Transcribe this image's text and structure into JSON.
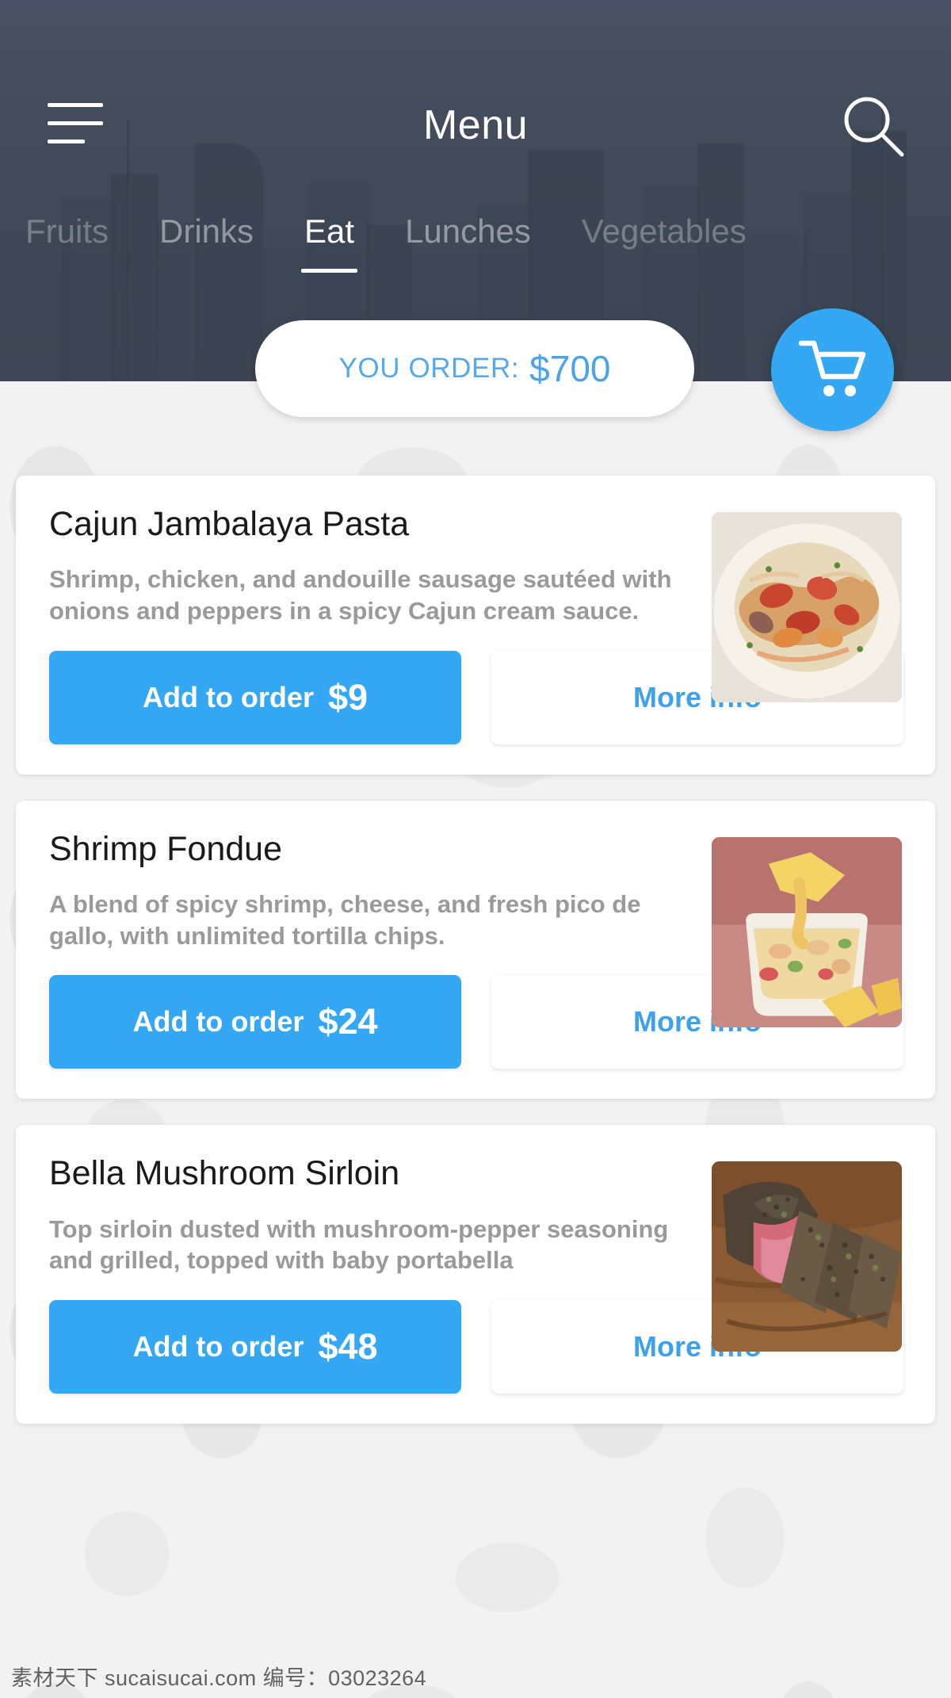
{
  "header": {
    "title": "Menu",
    "menu_icon": "hamburger-icon",
    "search_icon": "search-icon"
  },
  "tabs": [
    {
      "label": "Fruits",
      "active": false
    },
    {
      "label": "Drinks",
      "active": false
    },
    {
      "label": "Eat",
      "active": true
    },
    {
      "label": "Lunches",
      "active": false
    },
    {
      "label": "Vegetables",
      "active": false
    }
  ],
  "order_bar": {
    "label": "YOU ORDER:",
    "amount": "$700",
    "cart_icon": "shopping-cart-icon"
  },
  "items": [
    {
      "title": "Cajun Jambalaya Pasta",
      "description": "Shrimp, chicken, and andouille sausage sautéed with onions and peppers in a spicy Cajun cream sauce.",
      "add_label": "Add to order",
      "price": "$9",
      "info_label": "More info",
      "thumb": "pasta-shrimp-photo"
    },
    {
      "title": "Shrimp Fondue",
      "description": "A blend of spicy shrimp, cheese, and fresh pico de gallo, with unlimited tortilla chips.",
      "add_label": "Add to order",
      "price": "$24",
      "info_label": "More info",
      "thumb": "cheese-fondue-photo"
    },
    {
      "title": "Bella Mushroom Sirloin",
      "description": "Top sirloin dusted with mushroom-pepper seasoning and grilled, topped with baby portabella",
      "add_label": "Add to order",
      "price": "$48",
      "info_label": "More info",
      "thumb": "sliced-steak-photo"
    }
  ],
  "watermark": "素材天下 sucaisucai.com  编号：03023264",
  "colors": {
    "accent_blue": "#34a8f4",
    "header_slate": "#434c5b",
    "card_white": "#ffffff",
    "page_gray": "#f2f2f2",
    "desc_gray": "#9a9a9a"
  }
}
